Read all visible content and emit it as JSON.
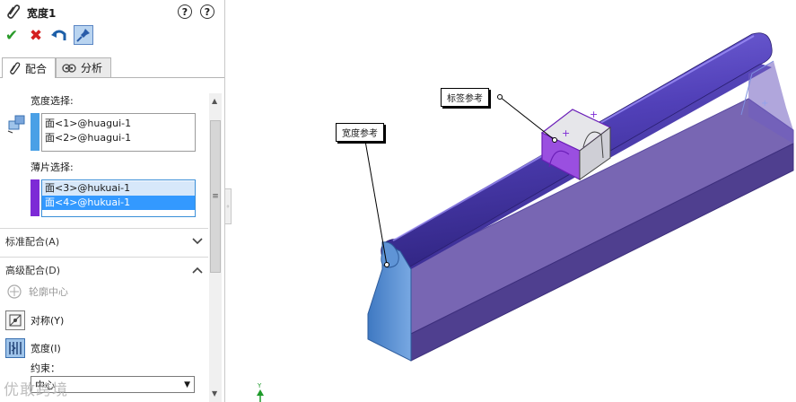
{
  "feature": {
    "title": "宽度1"
  },
  "toolbar": {
    "ok_icon": "check-icon",
    "cancel_icon": "close-icon",
    "undo_icon": "undo-icon",
    "pin_icon": "pin-icon"
  },
  "tabs": [
    {
      "label": "配合"
    },
    {
      "label": "分析"
    }
  ],
  "width_selection": {
    "label": "宽度选择:",
    "items": [
      "面<1>@huagui-1",
      "面<2>@huagui-1"
    ],
    "color": "#4aa0e6"
  },
  "tab_selection": {
    "label": "薄片选择:",
    "items": [
      "面<3>@hukuai-1",
      "面<4>@hukuai-1"
    ],
    "color": "#7d2ad6"
  },
  "groups": {
    "standard": "标准配合(A)",
    "advanced": "高级配合(D)"
  },
  "advanced_options": {
    "profile_center": "轮廓中心",
    "symmetric": "对称(Y)",
    "width": "宽度(I)",
    "constraint_label": "约束：",
    "constraint_value": "中心"
  },
  "callouts": {
    "width_ref": "宽度参考",
    "tab_ref": "标签参考"
  },
  "watermark": "优敢跨境",
  "colors": {
    "accent": "#3399ff",
    "rail": "#6a55b8",
    "block": "#8a3fd9",
    "support": "#5a8fd0"
  }
}
